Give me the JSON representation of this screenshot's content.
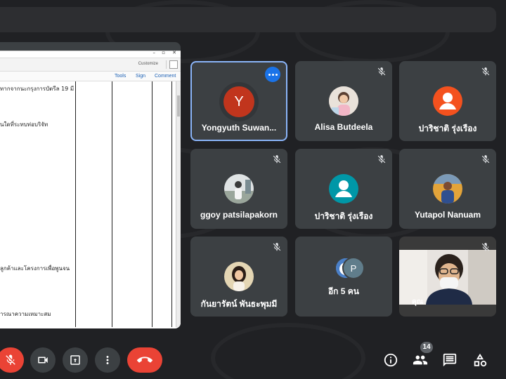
{
  "share": {
    "toolbar_label": "Customize",
    "tabs": [
      "Tools",
      "Sign",
      "Comment"
    ],
    "lines": [
      "ทากจากนะกรุงการบัตรีล 19 มี",
      "นใดที่ระทบท่อบริจัท",
      "ลูกค้าและโครงการเพื่อพูนจน",
      "ารณาความเหมาะสม"
    ]
  },
  "participants": [
    {
      "name": "Yongyuth Suwan...",
      "initial": "Y",
      "avatar_color": "#c1351d",
      "speaking": true
    },
    {
      "name": "Alisa Butdeela"
    },
    {
      "name": "ปาริชาติ รุ่งเรือง",
      "avatar_color": "#f4511e"
    },
    {
      "name": "ggoy patsilapakorn"
    },
    {
      "name": "ปาริชาติ รุ่งเรือง",
      "avatar_color": "#0097a7"
    },
    {
      "name": "Yutapol Nanuam"
    },
    {
      "name": "กันยารัตน์ พันธะพุมมี"
    },
    {
      "name": "อีก 5 คน",
      "second_initial": "P"
    },
    {
      "name": "คุณ"
    }
  ],
  "controls": {
    "participant_count": "14",
    "icons": [
      "mic-off-icon",
      "camera-icon",
      "present-icon",
      "more-vert-icon",
      "end-call-icon",
      "info-icon",
      "people-icon",
      "chat-icon",
      "activities-icon"
    ]
  },
  "colors": {
    "background": "#202124",
    "tile": "#3c4043",
    "mic_off": "#ea4335",
    "end_call": "#ea4335",
    "speaking_border": "#8ab4f8",
    "more_button": "#1a73e8"
  }
}
